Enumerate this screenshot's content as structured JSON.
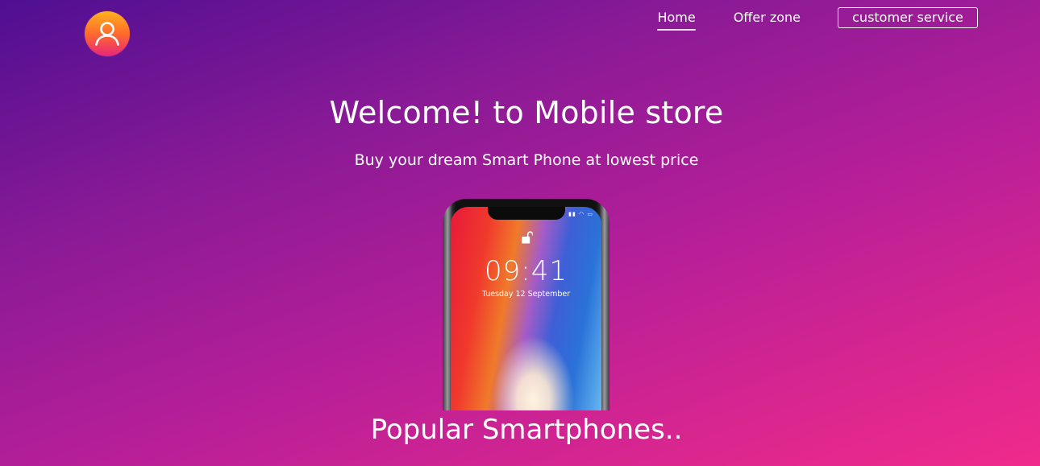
{
  "header": {
    "logo_icon": "user-icon",
    "nav": {
      "home_label": "Home",
      "offer_label": "Offer zone",
      "service_label": "customer service"
    }
  },
  "hero": {
    "title": "Welcome! to Mobile store",
    "subtitle": "Buy your dream Smart Phone at lowest price"
  },
  "phone_screen": {
    "time": "09:41",
    "date": "Tuesday 12 September",
    "lock_icon": "unlock-icon"
  },
  "section": {
    "title": "Popular Smartphones.."
  },
  "colors": {
    "gradient_start": "#4f0f92",
    "gradient_end": "#f02a8c",
    "logo_top": "#ffb21e",
    "logo_bottom": "#e8257c"
  }
}
